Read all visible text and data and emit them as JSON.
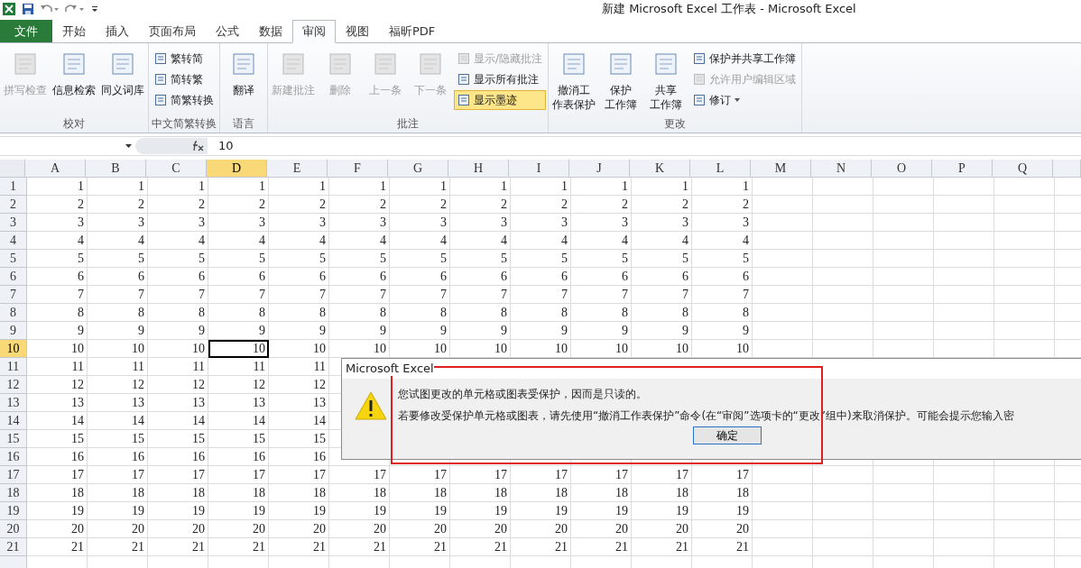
{
  "window": {
    "title": "新建 Microsoft Excel 工作表 - Microsoft Excel"
  },
  "tabs": [
    {
      "label": "文件",
      "kind": "file",
      "selected": false
    },
    {
      "label": "开始",
      "kind": "tab",
      "selected": false
    },
    {
      "label": "插入",
      "kind": "tab",
      "selected": false
    },
    {
      "label": "页面布局",
      "kind": "tab",
      "selected": false
    },
    {
      "label": "公式",
      "kind": "tab",
      "selected": false
    },
    {
      "label": "数据",
      "kind": "tab",
      "selected": false
    },
    {
      "label": "审阅",
      "kind": "tab",
      "selected": true
    },
    {
      "label": "视图",
      "kind": "tab",
      "selected": false
    },
    {
      "label": "福昕PDF",
      "kind": "tab",
      "selected": false
    }
  ],
  "ribbon": {
    "groups": [
      {
        "label": "校对",
        "items": [
          {
            "kind": "large",
            "lines": [
              "拼写检查"
            ],
            "disabled": true
          },
          {
            "kind": "large",
            "lines": [
              "信息检索"
            ],
            "disabled": false
          },
          {
            "kind": "large",
            "lines": [
              "同义词库"
            ],
            "disabled": false
          }
        ]
      },
      {
        "label": "中文简繁转换",
        "items": [
          {
            "kind": "small",
            "label": "繁转简",
            "disabled": false
          },
          {
            "kind": "small",
            "label": "简转繁",
            "disabled": false
          },
          {
            "kind": "small",
            "label": "简繁转换",
            "disabled": false
          }
        ]
      },
      {
        "label": "语言",
        "items": [
          {
            "kind": "large",
            "lines": [
              "翻译"
            ],
            "disabled": false
          }
        ]
      },
      {
        "label": "批注",
        "items": [
          {
            "kind": "large",
            "lines": [
              "新建批注"
            ],
            "disabled": true
          },
          {
            "kind": "large",
            "lines": [
              "删除"
            ],
            "disabled": true
          },
          {
            "kind": "large",
            "lines": [
              "上一条"
            ],
            "disabled": true
          },
          {
            "kind": "large",
            "lines": [
              "下一条"
            ],
            "disabled": true
          },
          {
            "kind": "small",
            "label": "显示/隐藏批注",
            "disabled": true,
            "selected": false
          },
          {
            "kind": "small",
            "label": "显示所有批注",
            "disabled": false,
            "selected": false
          },
          {
            "kind": "small",
            "label": "显示墨迹",
            "disabled": false,
            "selected": true
          }
        ]
      },
      {
        "label": "更改",
        "items": [
          {
            "kind": "large",
            "lines": [
              "撤消工",
              "作表保护"
            ],
            "disabled": false
          },
          {
            "kind": "large",
            "lines": [
              "保护",
              "工作簿"
            ],
            "disabled": false
          },
          {
            "kind": "large",
            "lines": [
              "共享",
              "工作簿"
            ],
            "disabled": false
          },
          {
            "kind": "small",
            "label": "保护并共享工作簿",
            "disabled": false
          },
          {
            "kind": "small",
            "label": "允许用户编辑区域",
            "disabled": true
          },
          {
            "kind": "small",
            "label": "修订",
            "disabled": false,
            "dropdown": true
          }
        ]
      }
    ]
  },
  "formula_bar": {
    "value": "10"
  },
  "sheet": {
    "columns": [
      {
        "label": "A",
        "selected": false
      },
      {
        "label": "B",
        "selected": false
      },
      {
        "label": "C",
        "selected": false
      },
      {
        "label": "D",
        "selected": true
      },
      {
        "label": "E",
        "selected": false
      },
      {
        "label": "F",
        "selected": false
      },
      {
        "label": "G",
        "selected": false
      },
      {
        "label": "H",
        "selected": false
      },
      {
        "label": "I",
        "selected": false
      },
      {
        "label": "J",
        "selected": false
      },
      {
        "label": "K",
        "selected": false
      },
      {
        "label": "L",
        "selected": false
      },
      {
        "label": "M",
        "selected": false
      },
      {
        "label": "N",
        "selected": false
      },
      {
        "label": "O",
        "selected": false
      },
      {
        "label": "P",
        "selected": false
      },
      {
        "label": "Q",
        "selected": false
      }
    ],
    "rows": [
      {
        "header": "1",
        "selected": false,
        "cells": [
          "1",
          "1",
          "1",
          "1",
          "1",
          "1",
          "1",
          "1",
          "1",
          "1",
          "1",
          "1"
        ]
      },
      {
        "header": "2",
        "selected": false,
        "cells": [
          "2",
          "2",
          "2",
          "2",
          "2",
          "2",
          "2",
          "2",
          "2",
          "2",
          "2",
          "2"
        ]
      },
      {
        "header": "3",
        "selected": false,
        "cells": [
          "3",
          "3",
          "3",
          "3",
          "3",
          "3",
          "3",
          "3",
          "3",
          "3",
          "3",
          "3"
        ]
      },
      {
        "header": "4",
        "selected": false,
        "cells": [
          "4",
          "4",
          "4",
          "4",
          "4",
          "4",
          "4",
          "4",
          "4",
          "4",
          "4",
          "4"
        ]
      },
      {
        "header": "5",
        "selected": false,
        "cells": [
          "5",
          "5",
          "5",
          "5",
          "5",
          "5",
          "5",
          "5",
          "5",
          "5",
          "5",
          "5"
        ]
      },
      {
        "header": "6",
        "selected": false,
        "cells": [
          "6",
          "6",
          "6",
          "6",
          "6",
          "6",
          "6",
          "6",
          "6",
          "6",
          "6",
          "6"
        ]
      },
      {
        "header": "7",
        "selected": false,
        "cells": [
          "7",
          "7",
          "7",
          "7",
          "7",
          "7",
          "7",
          "7",
          "7",
          "7",
          "7",
          "7"
        ]
      },
      {
        "header": "8",
        "selected": false,
        "cells": [
          "8",
          "8",
          "8",
          "8",
          "8",
          "8",
          "8",
          "8",
          "8",
          "8",
          "8",
          "8"
        ]
      },
      {
        "header": "9",
        "selected": false,
        "cells": [
          "9",
          "9",
          "9",
          "9",
          "9",
          "9",
          "9",
          "9",
          "9",
          "9",
          "9",
          "9"
        ]
      },
      {
        "header": "10",
        "selected": true,
        "cells": [
          "10",
          "10",
          "10",
          "10",
          "10",
          "10",
          "10",
          "10",
          "10",
          "10",
          "10",
          "10"
        ]
      },
      {
        "header": "11",
        "selected": false,
        "cells": [
          "11",
          "11",
          "11",
          "11",
          "11"
        ]
      },
      {
        "header": "12",
        "selected": false,
        "cells": [
          "12",
          "12",
          "12",
          "12",
          "12"
        ]
      },
      {
        "header": "13",
        "selected": false,
        "cells": [
          "13",
          "13",
          "13",
          "13",
          "13"
        ]
      },
      {
        "header": "14",
        "selected": false,
        "cells": [
          "14",
          "14",
          "14",
          "14",
          "14"
        ]
      },
      {
        "header": "15",
        "selected": false,
        "cells": [
          "15",
          "15",
          "15",
          "15",
          "15"
        ]
      },
      {
        "header": "16",
        "selected": false,
        "cells": [
          "16",
          "16",
          "16",
          "16",
          "16"
        ]
      },
      {
        "header": "17",
        "selected": false,
        "cells": [
          "17",
          "17",
          "17",
          "17",
          "17",
          "17",
          "17",
          "17",
          "17",
          "17",
          "17",
          "17"
        ]
      },
      {
        "header": "18",
        "selected": false,
        "cells": [
          "18",
          "18",
          "18",
          "18",
          "18",
          "18",
          "18",
          "18",
          "18",
          "18",
          "18",
          "18"
        ]
      },
      {
        "header": "19",
        "selected": false,
        "cells": [
          "19",
          "19",
          "19",
          "19",
          "19",
          "19",
          "19",
          "19",
          "19",
          "19",
          "19",
          "19"
        ]
      },
      {
        "header": "20",
        "selected": false,
        "cells": [
          "20",
          "20",
          "20",
          "20",
          "20",
          "20",
          "20",
          "20",
          "20",
          "20",
          "20",
          "20"
        ]
      },
      {
        "header": "21",
        "selected": false,
        "cells": [
          "21",
          "21",
          "21",
          "21",
          "21",
          "21",
          "21",
          "21",
          "21",
          "21",
          "21",
          "21"
        ]
      }
    ]
  },
  "dialog": {
    "title": "Microsoft Excel",
    "messages": [
      "您试图更改的单元格或图表受保护，因而是只读的。",
      "若要修改受保护单元格或图表，请先使用“撤消工作表保护”命令(在“审阅”选项卡的“更改”组中)来取消保护。可能会提示您输入密"
    ],
    "button": "确定"
  }
}
